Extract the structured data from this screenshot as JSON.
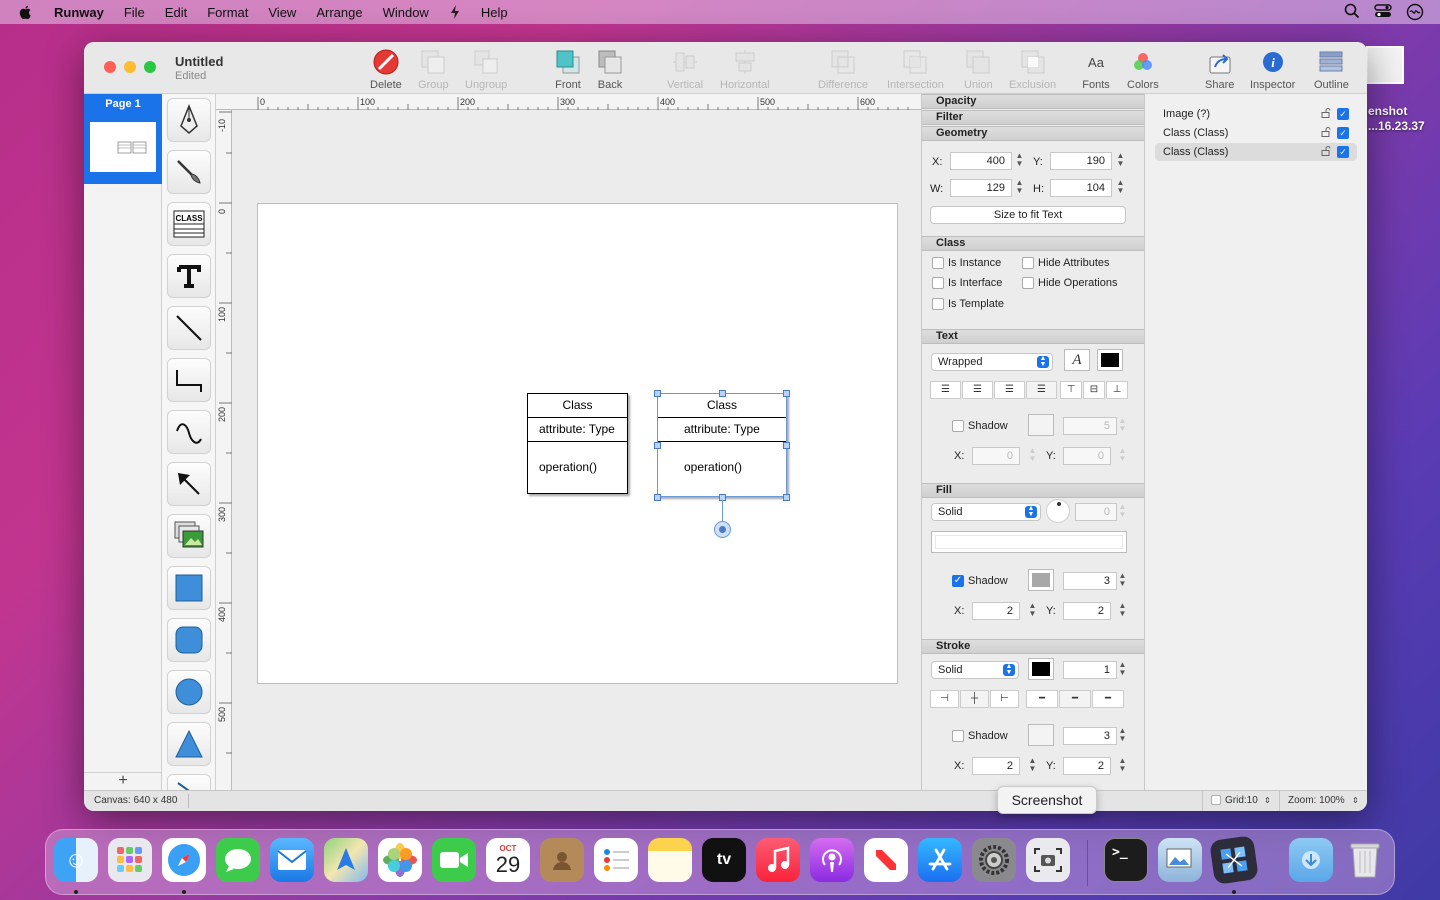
{
  "menubar": {
    "app": "Runway",
    "items": [
      "File",
      "Edit",
      "Format",
      "View",
      "Arrange",
      "Window",
      "Help"
    ]
  },
  "desktop": {
    "label_line1": "enshot",
    "label_line2": "...16.23.37"
  },
  "window": {
    "title": "Untitled",
    "subtitle": "Edited"
  },
  "toolbar": {
    "delete": "Delete",
    "group": "Group",
    "ungroup": "Ungroup",
    "front": "Front",
    "back": "Back",
    "vertical": "Vertical",
    "horizontal": "Horizontal",
    "difference": "Difference",
    "intersection": "Intersection",
    "union": "Union",
    "exclusion": "Exclusion",
    "fonts": "Fonts",
    "colors": "Colors",
    "share": "Share",
    "inspector": "Inspector",
    "outline": "Outline"
  },
  "pages": {
    "page1": "Page 1",
    "add": "+"
  },
  "ruler": {
    "top": [
      "0",
      "100",
      "200",
      "300",
      "400",
      "500",
      "600"
    ],
    "left": [
      "-10",
      "0",
      "100",
      "200",
      "300",
      "400",
      "500"
    ]
  },
  "canvas": {
    "class1": {
      "name": "Class",
      "attribute": "attribute: Type",
      "operation": "operation()"
    },
    "class2": {
      "name": "Class",
      "attribute": "attribute: Type",
      "operation": "operation()"
    }
  },
  "inspector": {
    "opacity": "Opacity",
    "filter": "Filter",
    "geometry": "Geometry",
    "x_label": "X:",
    "x": "400",
    "y_label": "Y:",
    "y": "190",
    "w_label": "W:",
    "w": "129",
    "h_label": "H:",
    "h": "104",
    "size_to_fit": "Size to fit Text",
    "class_section": "Class",
    "is_instance": "Is Instance",
    "is_interface": "Is Interface",
    "is_template": "Is Template",
    "hide_attributes": "Hide Attributes",
    "hide_operations": "Hide Operations",
    "text_section": "Text",
    "wrapped": "Wrapped",
    "text_style": "A",
    "text_shadow": "Shadow",
    "text_shadow_blur": "5",
    "text_shadow_x": "0",
    "text_shadow_y": "0",
    "fill_section": "Fill",
    "fill_mode": "Solid",
    "fill_angle": "0",
    "fill_shadow": "Shadow",
    "fill_shadow_blur": "3",
    "fill_shadow_x": "2",
    "fill_shadow_y": "2",
    "stroke_section": "Stroke",
    "stroke_mode": "Solid",
    "stroke_width": "1",
    "stroke_shadow": "Shadow",
    "stroke_shadow_blur": "3",
    "stroke_shadow_x": "2",
    "stroke_shadow_y": "2",
    "axis_x": "X:",
    "axis_y": "Y:"
  },
  "outline": {
    "rows": [
      "Image (?)",
      "Class (Class)",
      "Class (Class)"
    ]
  },
  "statusbar": {
    "canvas": "Canvas: 640 x 480",
    "grid": "Grid:10",
    "zoom": "Zoom: 100%"
  },
  "tooltip": "Screenshot",
  "calendar": {
    "month": "OCT",
    "day": "29"
  },
  "dock": {
    "apps": [
      "finder-icon",
      "launchpad-icon",
      "safari-icon",
      "messages-icon",
      "mail-icon",
      "maps-icon",
      "photos-icon",
      "facetime-icon",
      "calendar-icon",
      "contacts-icon",
      "reminders-icon",
      "notes-icon",
      "tv-icon",
      "music-icon",
      "podcasts-icon",
      "news-icon",
      "appstore-icon",
      "system-preferences-icon",
      "screenshot-icon",
      "terminal-icon",
      "preview-icon",
      "runway-icon",
      "downloads-icon",
      "trash-icon"
    ],
    "tv": "tv"
  },
  "colors": {
    "accent": "#1a73e8",
    "selection": "#6c9bd8"
  }
}
